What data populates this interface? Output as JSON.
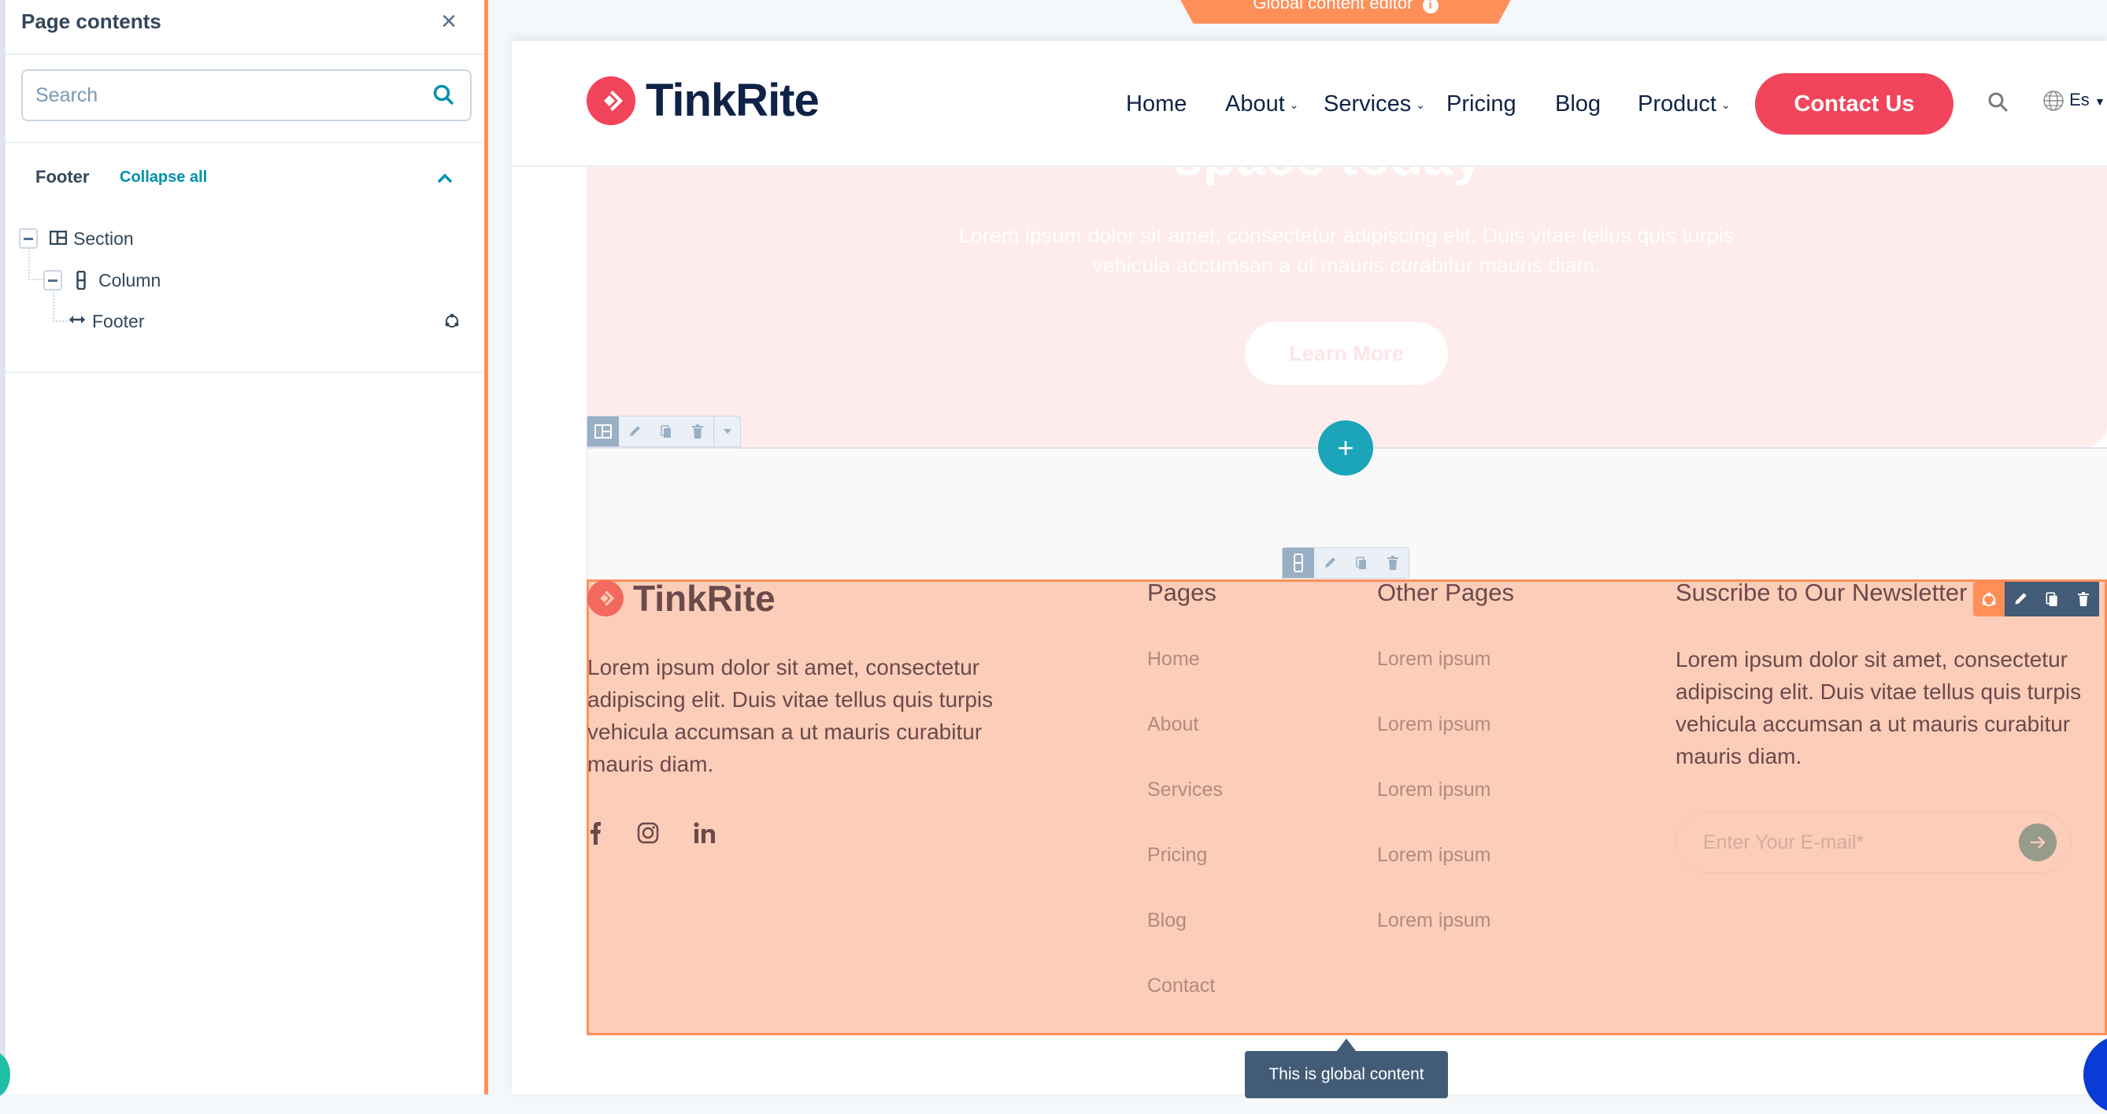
{
  "sidebar": {
    "title": "Page contents",
    "search_placeholder": "Search",
    "search_value": "",
    "group_title": "Footer",
    "collapse_all_label": "Collapse all",
    "tree": [
      {
        "label": "Section",
        "icon": "section-layout-icon",
        "level": 0
      },
      {
        "label": "Column",
        "icon": "column-icon",
        "level": 1
      },
      {
        "label": "Footer",
        "icon": "horizontal-arrows-icon",
        "level": 2,
        "badge": "global-content-icon"
      }
    ]
  },
  "editor": {
    "global_tab_label": "Global content editor",
    "tooltip": "This is global content",
    "colors": {
      "accent_orange": "#ff8f59",
      "teal": "#1ba4ba",
      "toolbar_dark": "#425b76"
    }
  },
  "site": {
    "brand": "TinkRite",
    "brand_color": "#f2445a",
    "nav": [
      {
        "label": "Home",
        "dropdown": false
      },
      {
        "label": "About",
        "dropdown": true
      },
      {
        "label": "Services",
        "dropdown": true
      },
      {
        "label": "Pricing",
        "dropdown": false
      },
      {
        "label": "Blog",
        "dropdown": false
      },
      {
        "label": "Product",
        "dropdown": true
      }
    ],
    "cta_label": "Contact Us",
    "language": "Es",
    "hero": {
      "title_fragment": "space today",
      "text": "Lorem ipsum dolor sit amet, consectetur adipiscing elit. Duis vitae tellus quis turpis vehicula accumsan a ut mauris curabitur mauris diam.",
      "button_label": "Learn More"
    },
    "footer": {
      "brand": "TinkRite",
      "about_text": "Lorem ipsum dolor sit amet, consectetur adipiscing elit. Duis vitae tellus quis turpis vehicula accumsan a ut mauris curabitur mauris diam.",
      "social": [
        "facebook",
        "instagram",
        "linkedin"
      ],
      "pages_heading": "Pages",
      "pages": [
        "Home",
        "About",
        "Services",
        "Pricing",
        "Blog",
        "Contact"
      ],
      "other_heading": "Other Pages",
      "other_pages": [
        "Lorem ipsum",
        "Lorem ipsum",
        "Lorem ipsum",
        "Lorem ipsum",
        "Lorem ipsum"
      ],
      "newsletter_heading": "Suscribe to Our Newsletter",
      "newsletter_text": "Lorem ipsum dolor sit amet, consectetur adipiscing elit. Duis vitae tellus quis turpis vehicula accumsan a ut mauris curabitur mauris diam.",
      "email_placeholder": "Enter Your E-mail*"
    }
  }
}
